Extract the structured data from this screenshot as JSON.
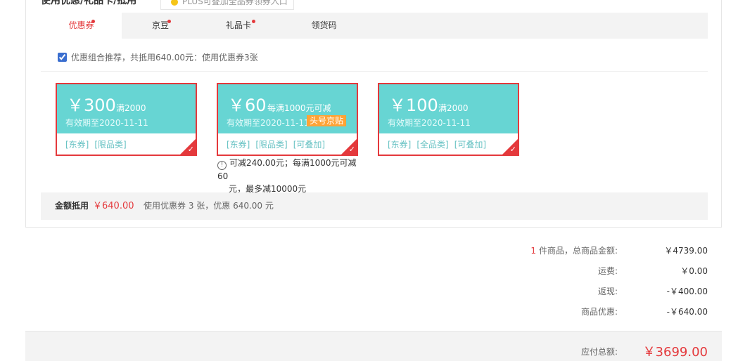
{
  "section": {
    "title": "使用优惠/礼品卡/抵用 ^",
    "plus_tip": "PLUS可叠加全品券领券入口"
  },
  "tabs": [
    {
      "label": "优惠券",
      "active": true,
      "dot": true
    },
    {
      "label": "京豆",
      "active": false,
      "dot": true
    },
    {
      "label": "礼品卡",
      "active": false,
      "dot": true
    },
    {
      "label": "领货码",
      "active": false,
      "dot": false
    }
  ],
  "combo": {
    "checked": true,
    "text": "优惠组合推荐，共抵用640.00元：使用优惠券3张"
  },
  "coupons": [
    {
      "amount": "￥300",
      "condition": "满2000",
      "valid": "有效期至2020-11-11",
      "badge": "",
      "tags": [
        "[东券]",
        "[限品类]"
      ]
    },
    {
      "amount": "￥60",
      "condition": "每满1000元可减",
      "valid": "有效期至2020-11-11",
      "badge": "头号京贴",
      "tags": [
        "[东券]",
        "[限品类]",
        "[可叠加]"
      ]
    },
    {
      "amount": "￥100",
      "condition": "满2000",
      "valid": "有效期至2020-11-11",
      "badge": "",
      "tags": [
        "[东券]",
        "[全品类]",
        "[可叠加]"
      ]
    }
  ],
  "coupon_note": {
    "line1": "可减240.00元；每满1000元可减60",
    "line2": "元，最多减10000元"
  },
  "deduction": {
    "label": "金额抵用",
    "amount": "￥640.00",
    "desc": "使用优惠券 3 张，优惠 640.00 元"
  },
  "totals": {
    "items_count": "1",
    "items_label": "件商品，总商品金额:",
    "items_value": "￥4739.00",
    "shipping_label": "运费:",
    "shipping_value": "￥0.00",
    "rebate_label": "返现:",
    "rebate_value": "-￥400.00",
    "discount_label": "商品优惠:",
    "discount_value": "-￥640.00",
    "payable_label": "应付总额:",
    "payable_value": "￥3699.00"
  },
  "colors": {
    "accent": "#e4393c",
    "coupon_bg": "#67d5d3",
    "badge": "#ffa336"
  }
}
